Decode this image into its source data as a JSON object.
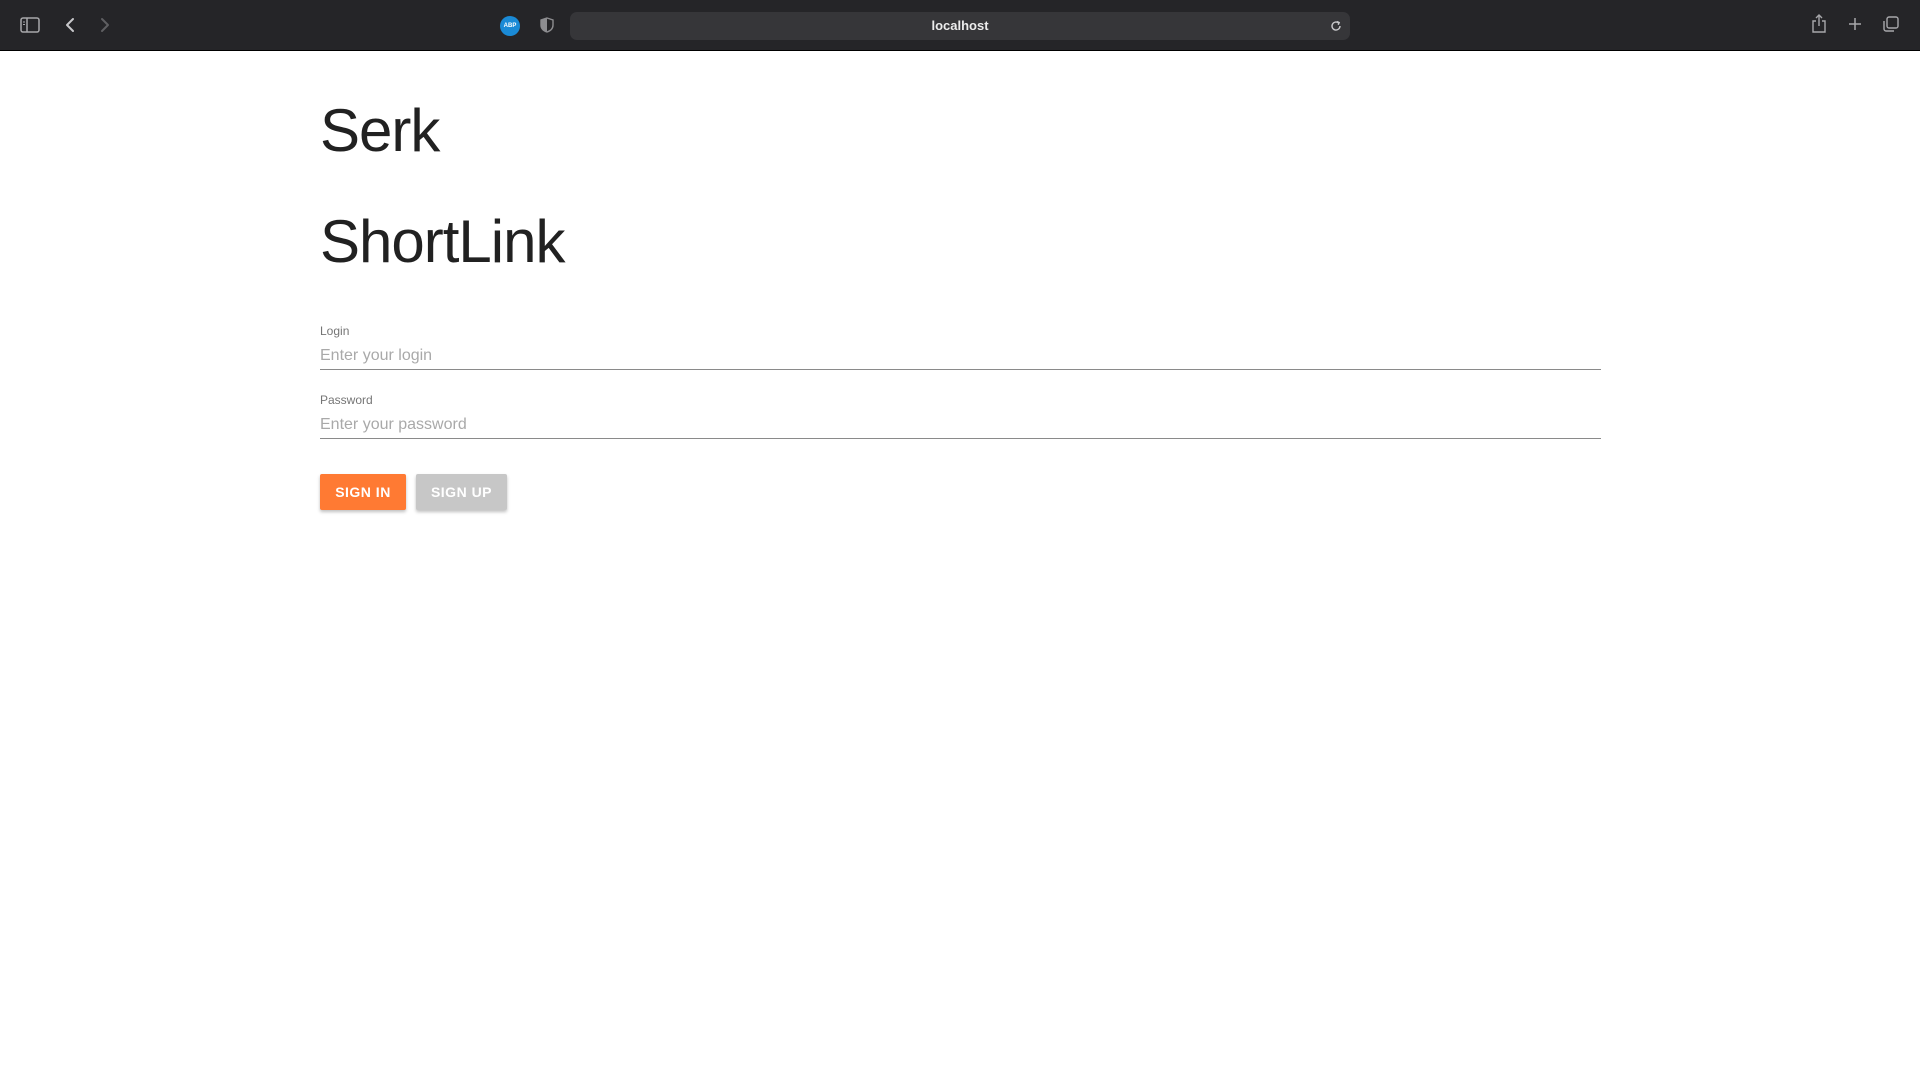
{
  "browser": {
    "url": "localhost",
    "extension_badge": "ABP",
    "icons": {
      "sidebar": "sidebar-icon",
      "back": "chevron-left-icon",
      "forward": "chevron-right-icon",
      "shield": "shield-icon",
      "reload": "reload-icon",
      "share": "share-icon",
      "new_tab": "plus-icon",
      "tabs": "tabs-overview-icon"
    }
  },
  "page": {
    "brand": "Serk",
    "app_title": "ShortLink",
    "login": {
      "label": "Login",
      "placeholder": "Enter your login",
      "value": ""
    },
    "password": {
      "label": "Password",
      "placeholder": "Enter your password",
      "value": ""
    },
    "sign_in_label": "SIGN IN",
    "sign_up_label": "SIGN UP"
  },
  "colors": {
    "toolbar": "#252528",
    "primary_button": "#ff7a33",
    "secondary_button": "#c7c7c7",
    "abp_badge": "#1a8ad6"
  }
}
